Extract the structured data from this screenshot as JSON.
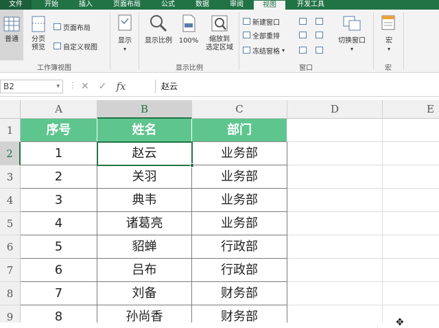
{
  "tabs": [
    "文件",
    "开始",
    "插入",
    "页面布局",
    "公式",
    "数据",
    "审阅",
    "视图",
    "开发工具"
  ],
  "ribbon": {
    "workbook_views": {
      "label": "工作簿视图",
      "normal": "普通",
      "page_break_line1": "分页",
      "page_break_line2": "预览",
      "page_layout": "页面布局",
      "custom_views": "自定义视图"
    },
    "show": {
      "label": "显示"
    },
    "zoom": {
      "label": "显示比例",
      "zoom": "显示比例",
      "zoom100": "100%",
      "zoom_sel_line1": "缩放到",
      "zoom_sel_line2": "选定区域"
    },
    "window": {
      "label": "窗口",
      "new_window": "新建窗口",
      "arrange_all": "全部重排",
      "freeze_panes": "冻结窗格",
      "switch_windows": "切换窗口"
    },
    "macros": {
      "label": "宏",
      "macros": "宏"
    }
  },
  "formula_bar": {
    "name_box": "B2",
    "fx": "fx",
    "content": "赵云"
  },
  "grid": {
    "columns": [
      "A",
      "B",
      "C",
      "D",
      "E"
    ],
    "rows": [
      "1",
      "2",
      "3",
      "4",
      "5",
      "6",
      "7",
      "8",
      "9"
    ],
    "header": [
      "序号",
      "姓名",
      "部门"
    ],
    "data": [
      [
        "1",
        "赵云",
        "业务部"
      ],
      [
        "2",
        "关羽",
        "业务部"
      ],
      [
        "3",
        "典韦",
        "业务部"
      ],
      [
        "4",
        "诸葛亮",
        "业务部"
      ],
      [
        "5",
        "貂蝉",
        "行政部"
      ],
      [
        "6",
        "吕布",
        "行政部"
      ],
      [
        "7",
        "刘备",
        "财务部"
      ],
      [
        "8",
        "孙尚香",
        "财务部"
      ]
    ],
    "selected_cell": "B2"
  },
  "colors": {
    "excel_green": "#217346",
    "header_fill": "#5ec58f"
  }
}
